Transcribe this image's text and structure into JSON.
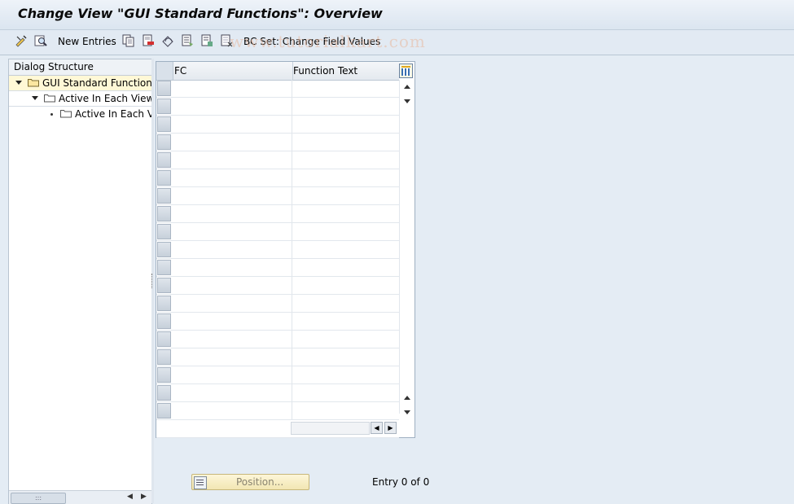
{
  "window": {
    "title": "Change View \"GUI Standard Functions\": Overview"
  },
  "toolbar": {
    "items": [
      {
        "icon": "display-change-icon"
      },
      {
        "icon": "details-icon"
      },
      {
        "label": "New Entries"
      },
      {
        "icon": "copy-as-icon"
      },
      {
        "icon": "delete-icon"
      },
      {
        "icon": "undo-change-icon"
      },
      {
        "icon": "select-all-icon"
      },
      {
        "icon": "select-block-icon"
      },
      {
        "icon": "deselect-all-icon"
      },
      {
        "label": "BC Set: Change Field Values"
      }
    ],
    "watermark": "www.tutorialkart.com"
  },
  "dialog_structure": {
    "header": "Dialog Structure",
    "nodes": [
      {
        "label": "GUI Standard Functions",
        "level": 0,
        "expanded": true,
        "selected": true
      },
      {
        "label": "Active In Each View",
        "level": 1,
        "expanded": true,
        "selected": false
      },
      {
        "label": "Active In Each Vi",
        "level": 2,
        "expanded": false,
        "selected": false
      }
    ]
  },
  "table": {
    "columns": [
      "FC",
      "Function Text"
    ],
    "rows": [
      "",
      "",
      "",
      "",
      "",
      "",
      "",
      "",
      "",
      "",
      "",
      "",
      "",
      "",
      "",
      "",
      "",
      "",
      "",
      ""
    ]
  },
  "footer": {
    "position_button": "Position...",
    "entry_text": "Entry 0 of 0"
  }
}
